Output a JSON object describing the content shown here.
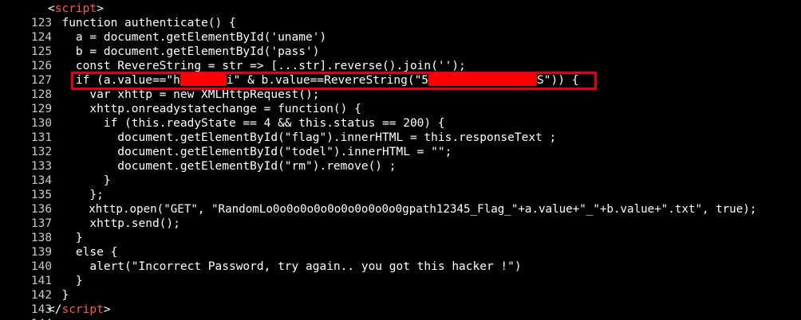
{
  "colors": {
    "background": "#000000",
    "text": "#ffffff",
    "line_number": "#c8c8c8",
    "tag": "#ff5555",
    "redaction": "#ff0000",
    "highlight_border": "#e0001a"
  },
  "lines": [
    {
      "num": "123",
      "pre": "<",
      "tag": "script",
      "post": ">"
    },
    {
      "num": "124",
      "text": "  function authenticate() {"
    },
    {
      "num": "125",
      "text": "    a = document.getElementById('uname')"
    },
    {
      "num": "126",
      "text": "    b = document.getElementById('pass')"
    },
    {
      "num": "127",
      "text": "    const RevereString = str => [...str].reverse().join('');"
    },
    {
      "num": "128",
      "part1": "    if (a.value==\"h",
      "part2": "i\" & b.value==RevereString(\"5",
      "part3": "S\")) {"
    },
    {
      "num": "129",
      "text": "      var xhttp = new XMLHttpRequest();"
    },
    {
      "num": "130",
      "text": "      xhttp.onreadystatechange = function() {"
    },
    {
      "num": "131",
      "text": "        if (this.readyState == 4 && this.status == 200) {"
    },
    {
      "num": "132",
      "text": "          document.getElementById(\"flag\").innerHTML = this.responseText ;"
    },
    {
      "num": "133",
      "text": "          document.getElementById(\"todel\").innerHTML = \"\";"
    },
    {
      "num": "134",
      "text": "          document.getElementById(\"rm\").remove() ;"
    },
    {
      "num": "135",
      "text": "        }"
    },
    {
      "num": "136",
      "text": "      };"
    },
    {
      "num": "137",
      "text": "      xhttp.open(\"GET\", \"RandomLo0o0o0o0o0o0o0o0o0o0gpath12345_Flag_\"+a.value+\"_\"+b.value+\".txt\", true);"
    },
    {
      "num": "138",
      "text": "      xhttp.send();"
    },
    {
      "num": "139",
      "text": "    }"
    },
    {
      "num": "140",
      "text": "    else {"
    },
    {
      "num": "141",
      "text": "      alert(\"Incorrect Password, try again.. you got this hacker !\")"
    },
    {
      "num": "142",
      "text": "    }"
    },
    {
      "num": "143",
      "text": "  }"
    },
    {
      "num": "144",
      "pre": "</",
      "tag": "script",
      "post": ">"
    }
  ]
}
